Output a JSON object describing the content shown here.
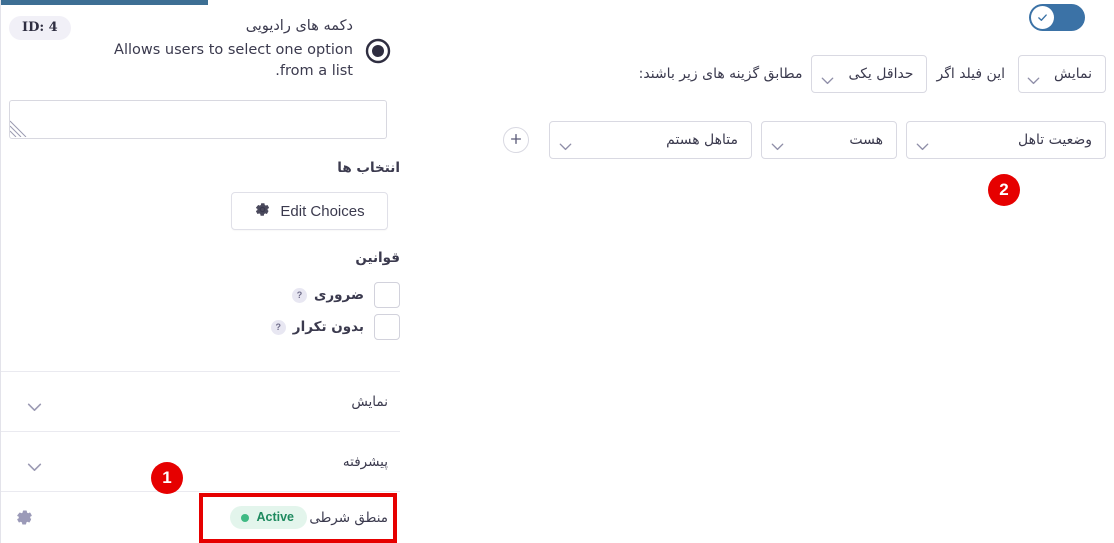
{
  "left_panel": {
    "id_badge": "ID: 4",
    "field_title": "دکمه های رادیویی",
    "field_description": "Allows users to select one option from a list.",
    "radio_icon": "radio-button-icon",
    "description_textarea_value": "",
    "description_textarea_placeholder": "",
    "choices_label": "انتخاب ها",
    "edit_choices_button": "Edit Choices",
    "edit_choices_icon": "gear-icon",
    "rules_label": "قوانین",
    "rules": [
      {
        "label": "ضروری",
        "help": "?",
        "checked": false
      },
      {
        "label": "بدون تکرار",
        "help": "?",
        "checked": false
      }
    ],
    "accordions": [
      {
        "name": "display",
        "title": "نمایش",
        "icon": "chevron-down-icon"
      },
      {
        "name": "advanced",
        "title": "پیشرفته",
        "icon": "chevron-down-icon"
      }
    ],
    "conditional_logic": {
      "title": "منطق شرطی",
      "status_label": "Active",
      "gear_icon": "gear-icon"
    }
  },
  "right_panel": {
    "toggle": {
      "state": "on",
      "icon": "check-icon"
    },
    "condition_header": {
      "action": "نمایش",
      "connector": "این فیلد اگر",
      "match": "حداقل یکی",
      "suffix": "مطابق گزینه های زیر باشند:"
    },
    "condition_row": {
      "field": "وضعیت تاهل",
      "operator": "هست",
      "value": "متاهل هستم",
      "add_icon": "plus-icon"
    }
  },
  "annotations": {
    "callouts": [
      {
        "number": "1",
        "target": "conditional-logic-row"
      },
      {
        "number": "2",
        "target": "condition-row"
      }
    ]
  },
  "colors": {
    "accent_bar": "#3d6f94",
    "toggle_on": "#3b72a6",
    "active_badge_bg": "#e3f5ec",
    "active_badge_text": "#1e8a5f",
    "callout_red": "#e60000",
    "text_primary": "#3b3a4e"
  }
}
